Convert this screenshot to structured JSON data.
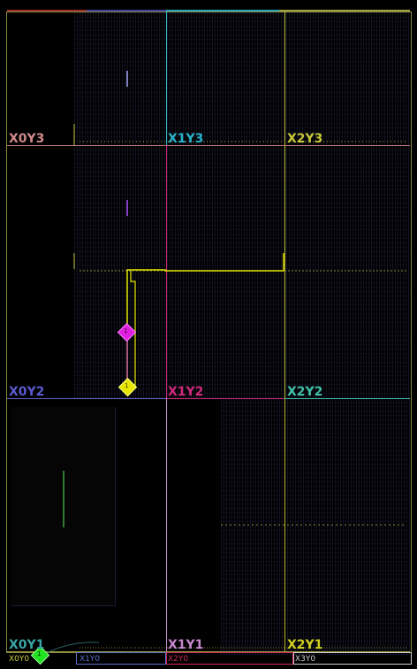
{
  "clock_regions": [
    {
      "name": "X0Y3",
      "color": "#d08a8a"
    },
    {
      "name": "X1Y3",
      "color": "#27b2c8"
    },
    {
      "name": "X2Y3",
      "color": "#c8c83a"
    },
    {
      "name": "X0Y2",
      "color": "#5a5ad0"
    },
    {
      "name": "X1Y2",
      "color": "#d0287a"
    },
    {
      "name": "X2Y2",
      "color": "#40c0a8"
    },
    {
      "name": "X0Y1",
      "color": "#3aa6a6"
    },
    {
      "name": "X1Y1",
      "color": "#c888d0"
    },
    {
      "name": "X2Y1",
      "color": "#d0d020"
    }
  ],
  "bottom_regions": [
    {
      "name": "X0Y0",
      "color": "#c8c83a"
    },
    {
      "name": "X1Y0",
      "color": "#5a70d0"
    },
    {
      "name": "X2Y0",
      "color": "#d02a5a"
    },
    {
      "name": "X3Y0",
      "color": "#cfcfcf"
    }
  ],
  "markers": [
    {
      "name": "magenta",
      "color": "#e020e0",
      "glyph": "1"
    },
    {
      "name": "yellow",
      "color": "#e6e600",
      "glyph": "1"
    },
    {
      "name": "green",
      "color": "#20e020",
      "glyph": "1"
    }
  ]
}
